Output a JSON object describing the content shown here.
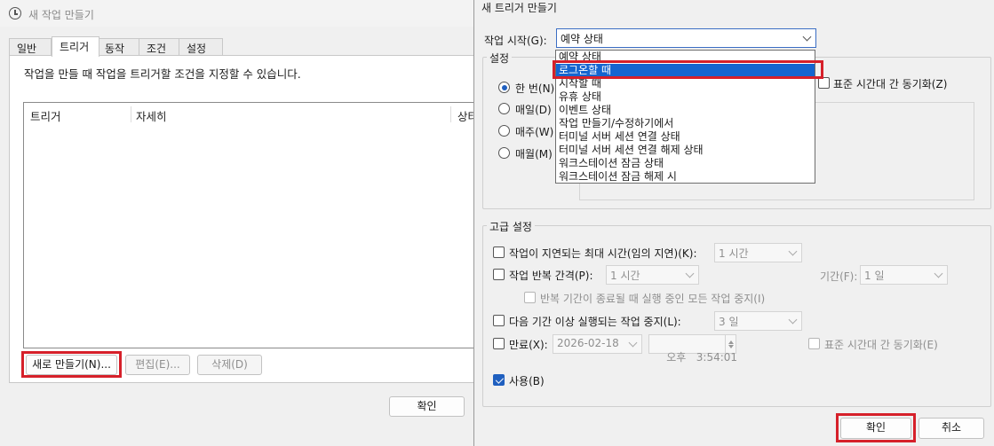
{
  "left_dialog": {
    "title": "새 작업 만들기",
    "tabs": [
      "일반",
      "트리거",
      "동작",
      "조건",
      "설정"
    ],
    "active_tab": "트리거",
    "description": "작업을 만들 때 작업을 트리거할 조건을 지정할 수 있습니다.",
    "columns": [
      "트리거",
      "자세히",
      "상타"
    ],
    "buttons": {
      "new": "새로 만들기(N)...",
      "edit": "편집(E)...",
      "delete": "삭제(D)",
      "ok": "확인"
    }
  },
  "right_dialog": {
    "title": "새 트리거 만들기",
    "begin_label": "작업 시작(G):",
    "begin_value": "예약 상태",
    "dropdown_options": [
      "예약 상태",
      "로그온할 때",
      "시작할 때",
      "유휴 상태",
      "이벤트 상태",
      "작업 만들기/수정하기에서",
      "터미널 서버 세션 연결 상태",
      "터미널 서버 세션 연결 해제 상태",
      "워크스테이션 잠금 상태",
      "워크스테이션 잠금 해제 시"
    ],
    "highlighted_option": "로그온할 때",
    "settings_group": "설정",
    "schedule_options": [
      "한 번(N)",
      "매일(D)",
      "매주(W)",
      "매월(M)"
    ],
    "selected_schedule": "한 번(N)",
    "sync_tz": "표준 시간대 간 동기화(Z)",
    "advanced": {
      "group": "고급 설정",
      "delay_label": "작업이 지연되는 최대 시간(임의 지연)(K):",
      "delay_value": "1 시간",
      "repeat_label": "작업 반복 간격(P):",
      "repeat_value": "1 시간",
      "duration_label": "기간(F):",
      "duration_value": "1 일",
      "stop_all_label": "반복 기간이 종료될 때 실행 중인 모든 작업 중지(I)",
      "stop_longer_label": "다음 기간 이상 실행되는 작업 중지(L):",
      "stop_longer_value": "3 일",
      "expire_label": "만료(X):",
      "expire_date": "2026-02-18",
      "expire_time": "오후   3:54:01",
      "expire_sync": "표준 시간대 간 동기화(E)",
      "enabled_label": "사용(B)"
    },
    "buttons": {
      "ok": "확인",
      "cancel": "취소"
    }
  },
  "colors": {
    "highlight": "#1565d0",
    "annotation_red": "#d6202a"
  }
}
